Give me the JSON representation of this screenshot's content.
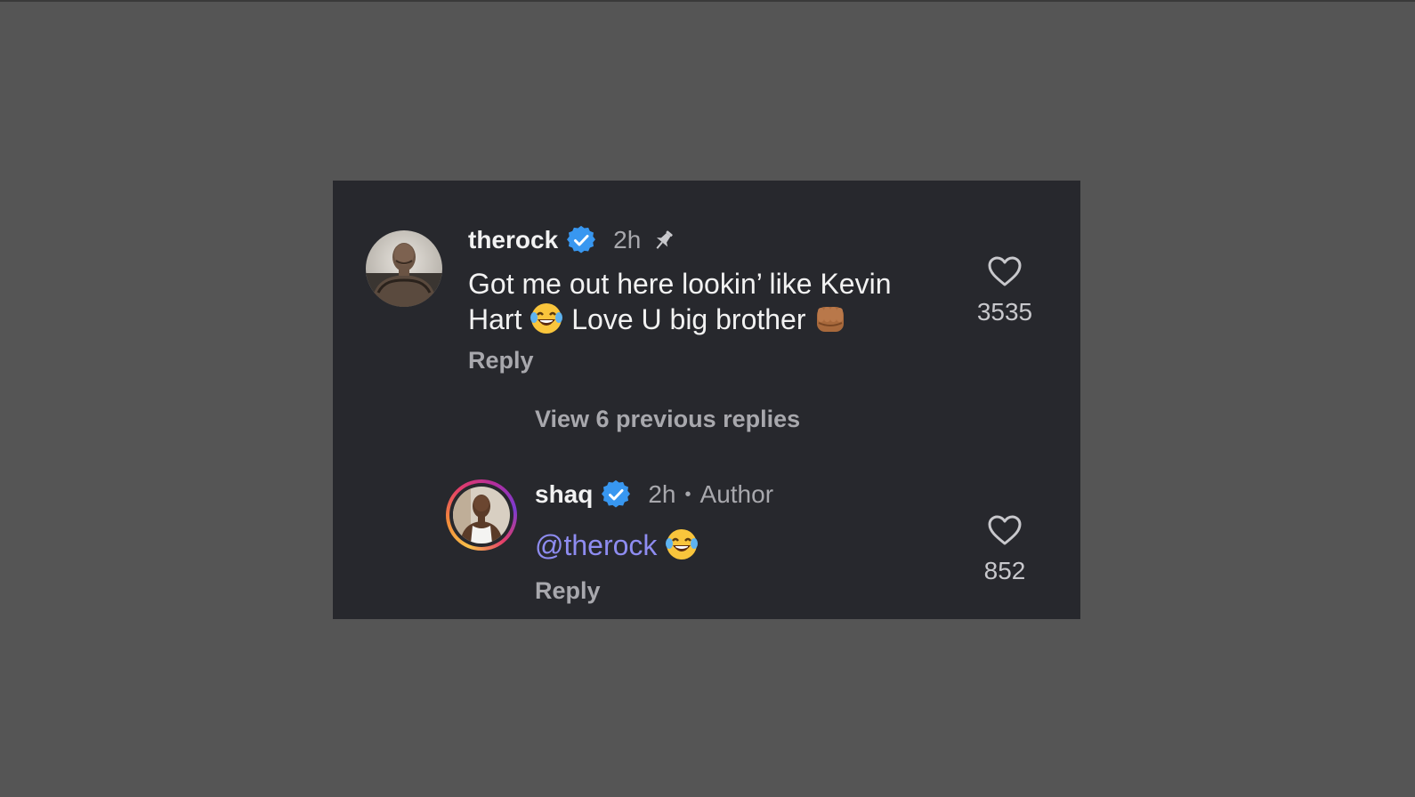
{
  "comments": [
    {
      "username": "therock",
      "verified": true,
      "time": "2h",
      "pinned": true,
      "text_line1": "Got me out here lookin’ like Kevin",
      "text_line2_a": "Hart",
      "text_line2_b": "Love U big brother",
      "emojis": [
        "face-with-tears-of-joy",
        "oncoming-fist-medium-dark"
      ],
      "reply_label": "Reply",
      "like_count": "3535",
      "icons": {
        "heart": "heart-outline-icon",
        "pin": "pin-icon",
        "verified": "verified-badge-icon"
      }
    },
    {
      "username": "shaq",
      "verified": true,
      "time": "2h",
      "separator": "•",
      "role_label": "Author",
      "mention": "@therock",
      "emojis": [
        "face-with-tears-of-joy"
      ],
      "reply_label": "Reply",
      "like_count": "852",
      "has_story_ring": true
    }
  ],
  "thread": {
    "view_replies_label": "View 6 previous replies"
  },
  "colors": {
    "page_background": "#555555",
    "card_background": "#27282d",
    "primary_text": "#f2f2f2",
    "secondary_text": "#a8a8ad",
    "mention": "#8e8cf0",
    "verified_blue": "#3897f0"
  }
}
